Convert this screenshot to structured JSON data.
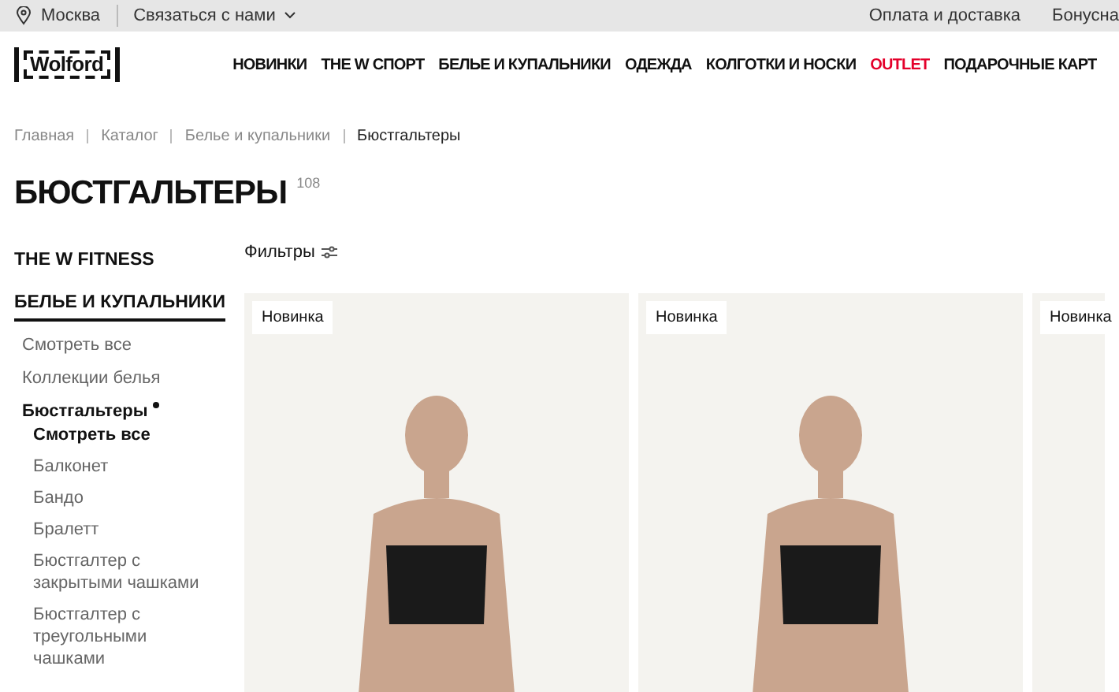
{
  "top_bar": {
    "city": "Москва",
    "contact": "Связаться с нами",
    "links": [
      "Оплата и доставка",
      "Бонусна"
    ]
  },
  "header": {
    "logo": "Wolford",
    "nav": [
      {
        "label": "НОВИНКИ",
        "color": "#111111"
      },
      {
        "label": "THE W СПОРТ",
        "color": "#111111"
      },
      {
        "label": "БЕЛЬЕ И КУПАЛЬНИКИ",
        "color": "#111111"
      },
      {
        "label": "ОДЕЖДА",
        "color": "#111111"
      },
      {
        "label": "КОЛГОТКИ И НОСКИ",
        "color": "#111111"
      },
      {
        "label": "OUTLET",
        "color": "#e4002b"
      },
      {
        "label": "ПОДАРОЧНЫЕ КАРТ",
        "color": "#111111"
      }
    ]
  },
  "breadcrumbs": [
    {
      "label": "Главная",
      "current": false
    },
    {
      "label": "Каталог",
      "current": false
    },
    {
      "label": "Белье и купальники",
      "current": false
    },
    {
      "label": "Бюстгальтеры",
      "current": true
    }
  ],
  "title": "БЮСТГАЛЬТЕРЫ",
  "count": "108",
  "sidebar": {
    "items": [
      {
        "label": "THE W FITNESS",
        "selected": false
      },
      {
        "label": "БЕЛЬЕ И КУПАЛЬНИКИ",
        "selected": true,
        "children": [
          {
            "label": "Смотреть все",
            "selected": false
          },
          {
            "label": "Коллекции белья",
            "selected": false
          },
          {
            "label": "Бюстгальтеры",
            "selected": true,
            "children": [
              {
                "label": "Смотреть все",
                "selected": true
              },
              {
                "label": "Балконет",
                "selected": false
              },
              {
                "label": "Бандо",
                "selected": false
              },
              {
                "label": "Бралетт",
                "selected": false
              },
              {
                "label": "Бюстгалтер с закрытыми чашками",
                "selected": false
              },
              {
                "label": "Бюстгалтер с треугольными чашками",
                "selected": false
              }
            ]
          }
        ]
      }
    ]
  },
  "filters": "Фильтры",
  "products": [
    {
      "badge": "Новинка"
    },
    {
      "badge": "Новинка"
    },
    {
      "badge": "Новинка"
    }
  ]
}
